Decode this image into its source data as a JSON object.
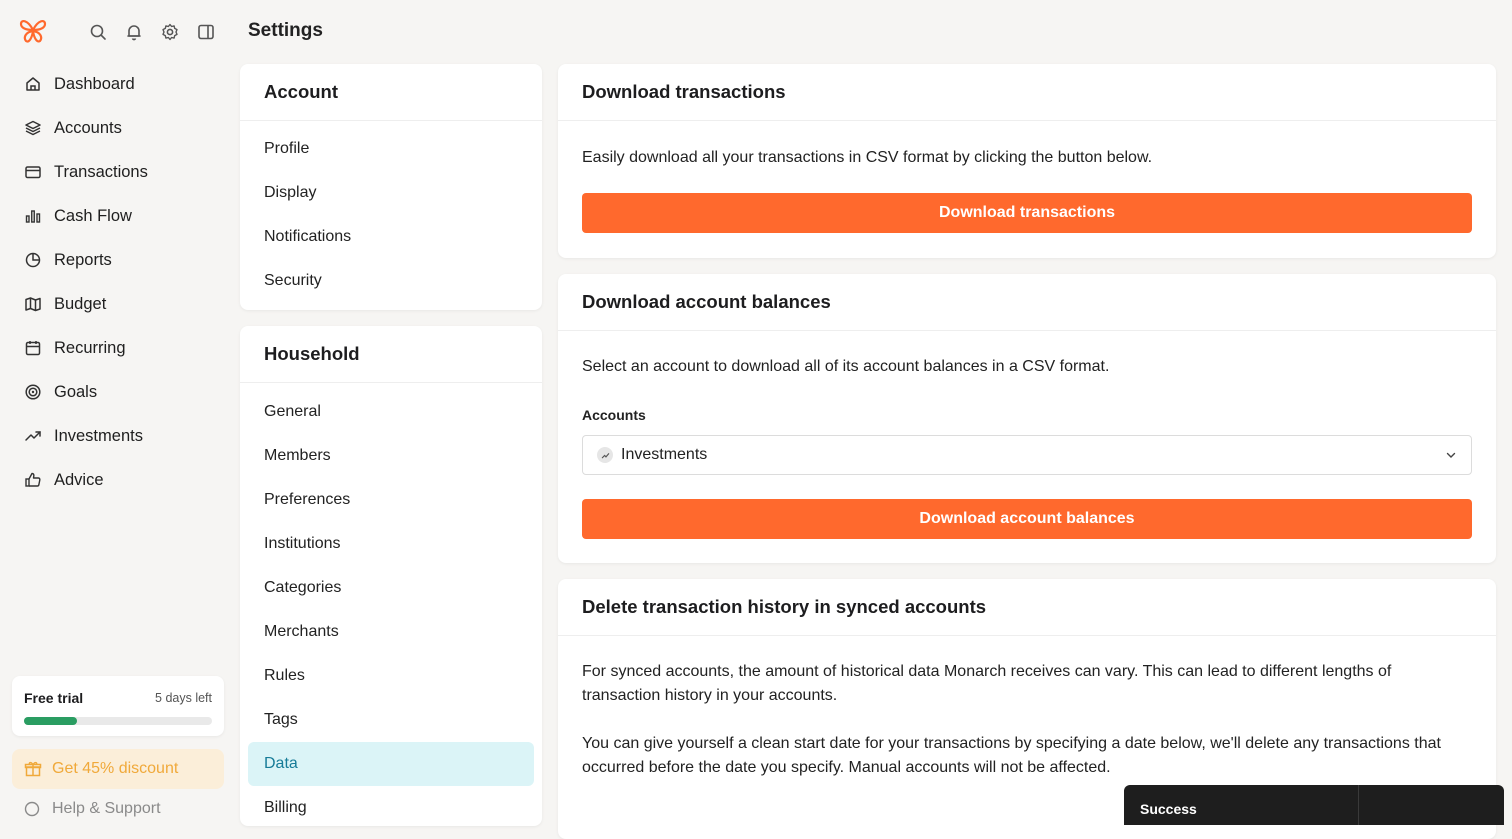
{
  "app": {
    "page_title": "Settings",
    "accent_color": "#ff692d",
    "top_icons": [
      "search-icon",
      "bell-icon",
      "gear-icon",
      "sidebar-toggle-icon"
    ]
  },
  "sidebar": {
    "items": [
      {
        "label": "Dashboard",
        "icon": "home-icon"
      },
      {
        "label": "Accounts",
        "icon": "layers-icon"
      },
      {
        "label": "Transactions",
        "icon": "credit-card-icon"
      },
      {
        "label": "Cash Flow",
        "icon": "bar-chart-icon"
      },
      {
        "label": "Reports",
        "icon": "pie-chart-icon"
      },
      {
        "label": "Budget",
        "icon": "map-icon"
      },
      {
        "label": "Recurring",
        "icon": "calendar-icon"
      },
      {
        "label": "Goals",
        "icon": "target-icon"
      },
      {
        "label": "Investments",
        "icon": "trending-up-icon"
      },
      {
        "label": "Advice",
        "icon": "thumbs-up-icon"
      }
    ],
    "trial": {
      "title": "Free trial",
      "days_left": "5 days left",
      "progress": 0.28
    },
    "discount_label": "Get 45% discount",
    "help_label": "Help & Support"
  },
  "settings_menu": {
    "account": {
      "title": "Account",
      "items": [
        "Profile",
        "Display",
        "Notifications",
        "Security"
      ]
    },
    "household": {
      "title": "Household",
      "items": [
        "General",
        "Members",
        "Preferences",
        "Institutions",
        "Categories",
        "Merchants",
        "Rules",
        "Tags",
        "Data",
        "Billing"
      ],
      "active": "Data"
    }
  },
  "download_transactions": {
    "title": "Download transactions",
    "description": "Easily download all your transactions in CSV format by clicking the button below.",
    "button": "Download transactions"
  },
  "download_balances": {
    "title": "Download account balances",
    "description": "Select an account to download all of its account balances in a CSV format.",
    "field_label": "Accounts",
    "selected": "Investments",
    "button": "Download account balances"
  },
  "delete_history": {
    "title": "Delete transaction history in synced accounts",
    "paragraph1": "For synced accounts, the amount of historical data Monarch receives can vary. This can lead to different lengths of transaction history in your accounts.",
    "paragraph2": "You can give yourself a clean start date for your transactions by specifying a date below, we'll delete any transactions that occurred before the date you specify. Manual accounts will not be affected."
  },
  "toast": {
    "text": "Success"
  }
}
